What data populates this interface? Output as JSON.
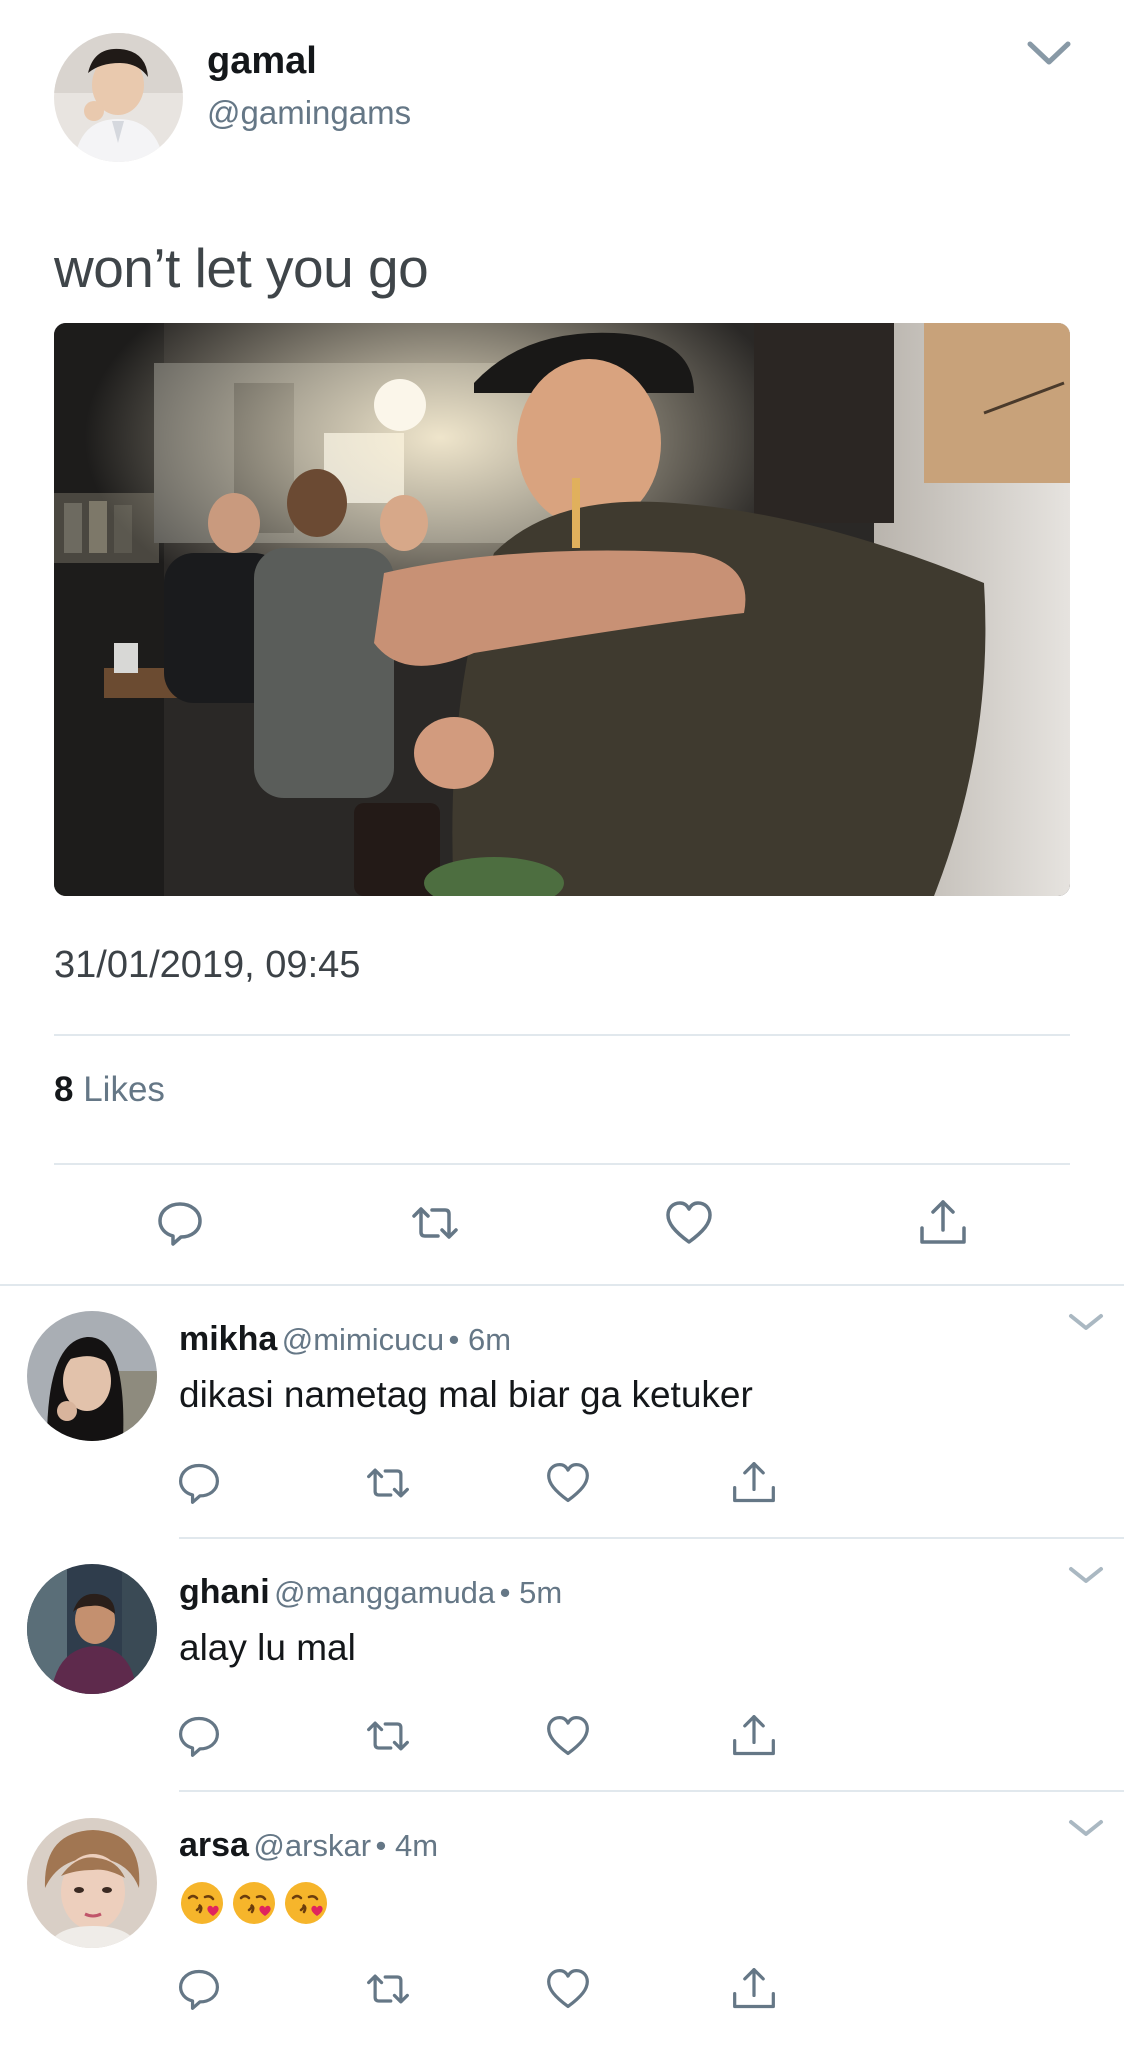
{
  "tweet": {
    "display_name": "gamal",
    "handle": "@gamingams",
    "text": "won’t let you go",
    "timestamp": "31/01/2019, 09:45",
    "likes_count": "8",
    "likes_label": "Likes"
  },
  "replies": [
    {
      "display_name": "mikha",
      "handle": "@mimicucu",
      "time": "• 6m",
      "text": "dikasi nametag mal biar ga ketuker"
    },
    {
      "display_name": "ghani",
      "handle": "@manggamuda",
      "time": "• 5m",
      "text": "alay lu mal"
    },
    {
      "display_name": "arsa",
      "handle": "@arskar",
      "time": "• 4m",
      "text": "",
      "emojis": [
        "kissing-heart-emoji",
        "kissing-heart-emoji",
        "kissing-heart-emoji"
      ]
    }
  ],
  "icons": {
    "reply": "reply-icon",
    "retweet": "retweet-icon",
    "like": "heart-icon",
    "share": "share-icon",
    "more": "chevron-down-icon"
  },
  "colors": {
    "icon_gray": "#657786",
    "divider": "#e1e8ed",
    "emoji_yellow": "#f6b52b",
    "emoji_heart": "#e0245e"
  }
}
